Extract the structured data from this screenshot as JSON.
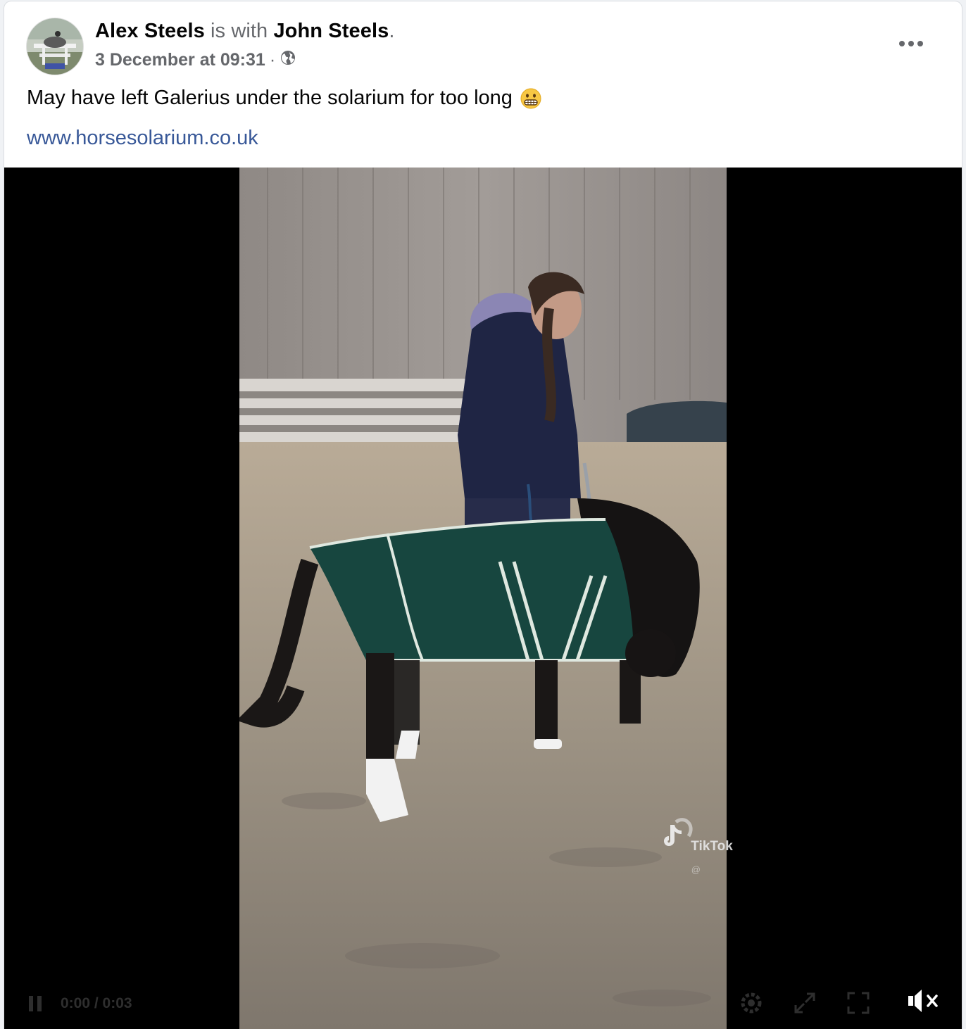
{
  "post": {
    "author": "Alex Steels",
    "with_text": " is with ",
    "tagged": "John Steels",
    "period": ".",
    "timestamp": "3 December at 09:31",
    "separator": "·",
    "audience_icon": "globe-icon",
    "more_icon": "ellipsis-icon",
    "text": "May have left Galerius under the solarium for too long",
    "emoji": "grimacing-face-emoji",
    "link": "www.horsesolarium.co.uk"
  },
  "video": {
    "watermark": "TikTok",
    "watermark_handle": "@",
    "controls": {
      "play_icon": "pause-icon",
      "time": "0:00 / 0:03",
      "settings_icon": "gear-icon",
      "expand_icon": "expand-icon",
      "fullscreen_icon": "fullscreen-icon",
      "mute_icon": "speaker-muted-icon"
    }
  },
  "colors": {
    "name": "#050505",
    "muted": "#65676b",
    "link": "#385898",
    "video_background": "#000000"
  }
}
